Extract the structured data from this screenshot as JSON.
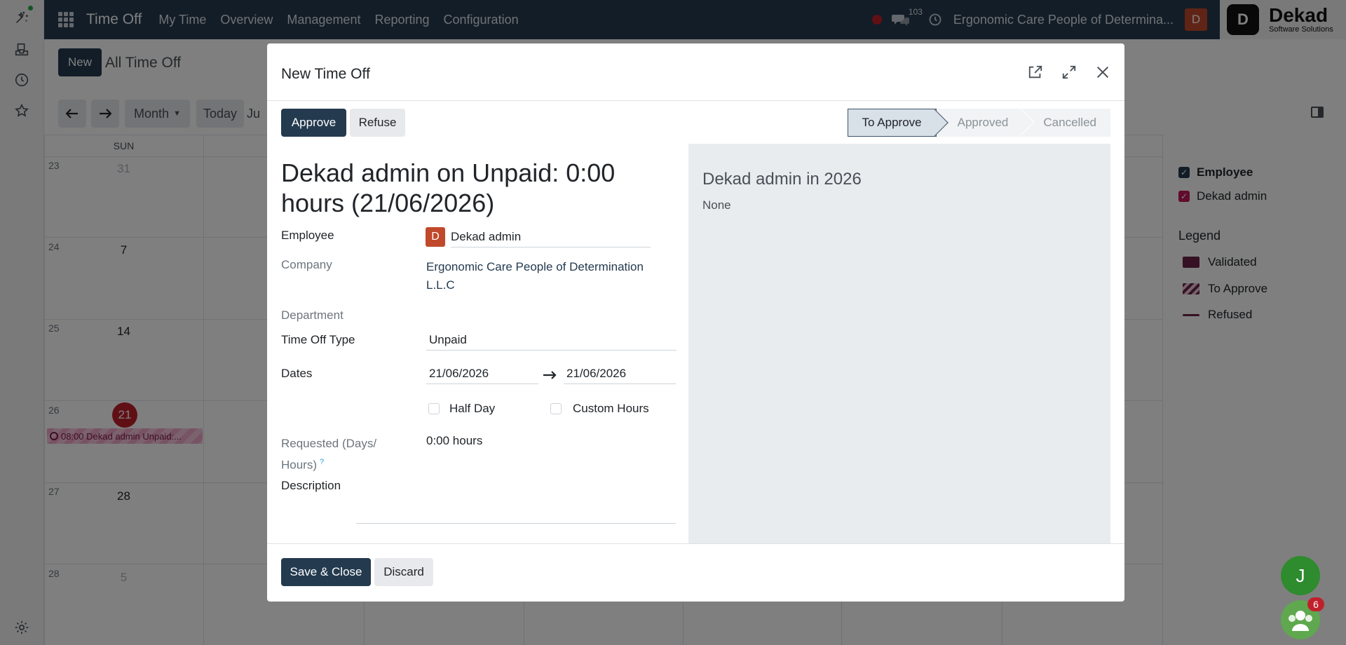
{
  "navbar": {
    "app_name": "Time Off",
    "menu": [
      "My Time",
      "Overview",
      "Management",
      "Reporting",
      "Configuration"
    ],
    "message_count": "103",
    "company": "Ergonomic Care People of Determina...",
    "user_initial": "D",
    "logo": {
      "name": "Dekad",
      "tagline": "Software Solutions"
    }
  },
  "control_panel": {
    "new_label": "New",
    "title": "All Time Off",
    "scale_label": "Month",
    "today_label": "Today",
    "month_partial": "Ju"
  },
  "calendar": {
    "header_day": "SUN",
    "weeks": [
      {
        "week": "23",
        "day": "31",
        "muted": true
      },
      {
        "week": "24",
        "day": "7"
      },
      {
        "week": "25",
        "day": "14"
      },
      {
        "week": "26",
        "day": "21",
        "today": true
      },
      {
        "week": "27",
        "day": "28"
      },
      {
        "week": "28",
        "day": "5",
        "muted": true
      }
    ],
    "event_label": "08:00 Dekad admin Unpaid:..."
  },
  "sidebar": {
    "filters": [
      {
        "label": "Employee",
        "color": "#243a4f"
      },
      {
        "label": "Dekad admin",
        "color": "#c2185b"
      }
    ],
    "legend_title": "Legend",
    "legend": [
      {
        "label": "Validated",
        "type": "solid",
        "color": "#6b2346"
      },
      {
        "label": "To Approve",
        "type": "striped",
        "color": "#6b2346"
      },
      {
        "label": "Refused",
        "type": "line",
        "color": "#6b2346"
      }
    ]
  },
  "dialog": {
    "title": "New Time Off",
    "approve_label": "Approve",
    "refuse_label": "Refuse",
    "status_steps": [
      "To Approve",
      "Approved",
      "Cancelled"
    ],
    "active_status": "To Approve",
    "record_name": "Dekad admin on Unpaid: 0:00 hours (21/06/2026)",
    "fields": {
      "employee_label": "Employee",
      "employee_value": "Dekad admin",
      "employee_initial": "D",
      "company_label": "Company",
      "company_value": "Ergonomic Care People of Determination L.L.C",
      "department_label": "Department",
      "type_label": "Time Off Type",
      "type_value": "Unpaid",
      "dates_label": "Dates",
      "date_from": "21/06/2026",
      "date_to": "21/06/2026",
      "half_day_label": "Half Day",
      "custom_hours_label": "Custom Hours",
      "requested_label_1": "Requested (Days/",
      "requested_label_2": "Hours)",
      "help_mark": "?",
      "requested_value": "0:00 hours",
      "description_label": "Description"
    },
    "side_panel": {
      "title": "Dekad admin in 2026",
      "value": "None"
    },
    "save_label": "Save & Close",
    "discard_label": "Discard"
  },
  "floating": {
    "avatar_initial": "J",
    "chat_badge": "6"
  }
}
